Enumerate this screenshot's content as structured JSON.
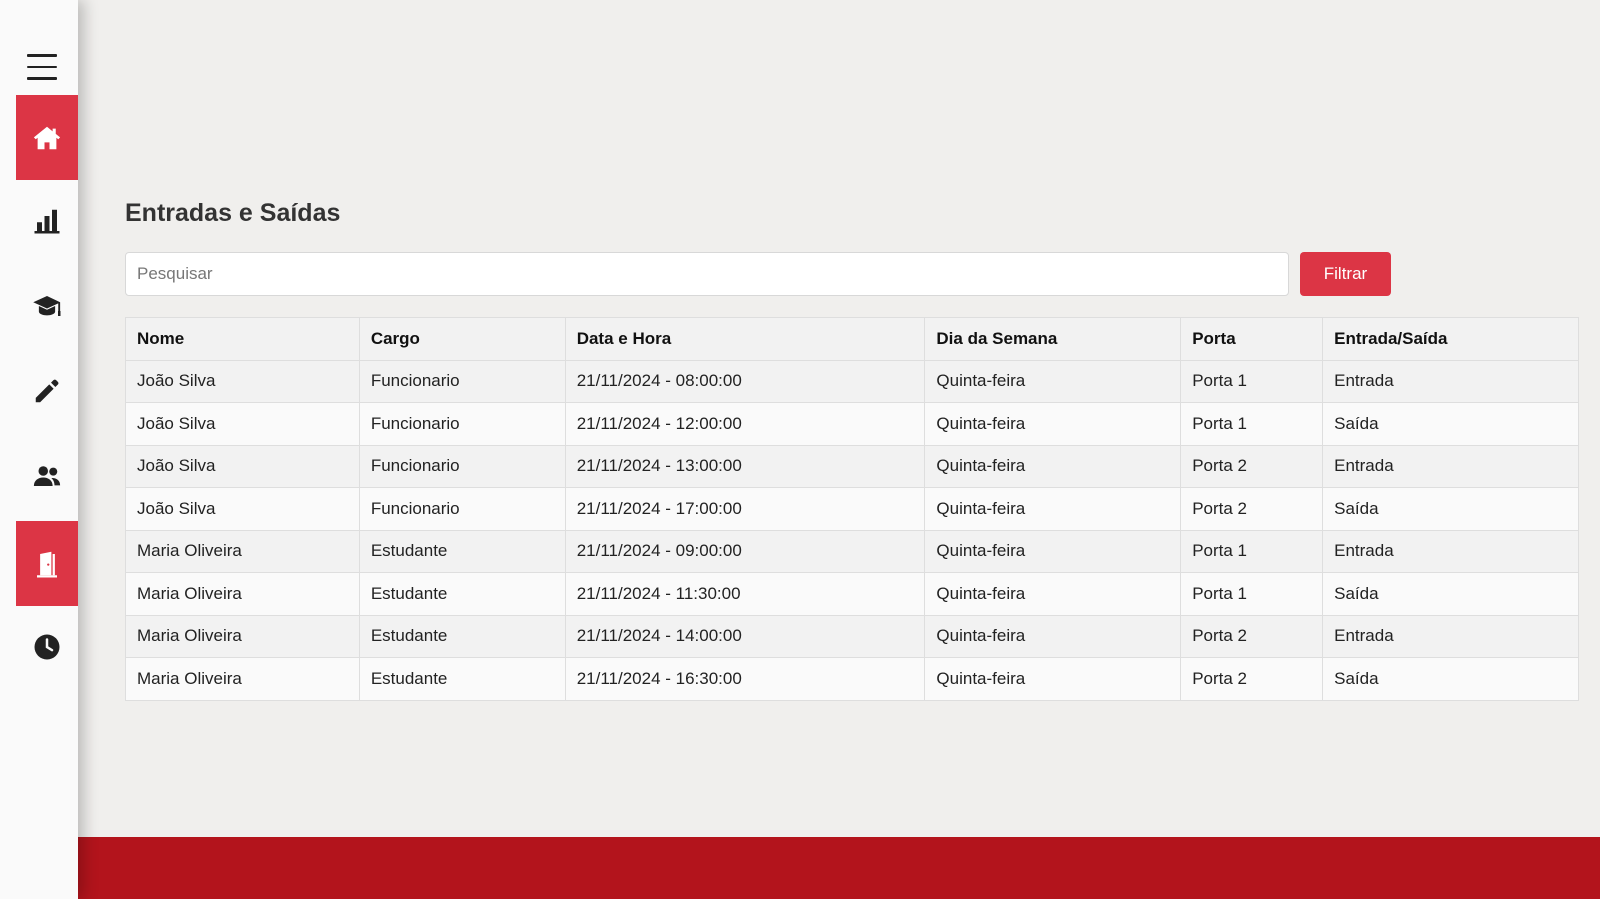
{
  "sidebar": {
    "items": [
      {
        "name": "home",
        "icon": "home-icon",
        "active": true
      },
      {
        "name": "reports",
        "icon": "bar-chart-icon",
        "active": false
      },
      {
        "name": "students",
        "icon": "graduation-cap-icon",
        "active": false
      },
      {
        "name": "edit",
        "icon": "pencil-icon",
        "active": false
      },
      {
        "name": "users",
        "icon": "users-icon",
        "active": false
      },
      {
        "name": "access",
        "icon": "door-icon",
        "active": true
      },
      {
        "name": "history",
        "icon": "clock-icon",
        "active": false
      }
    ]
  },
  "main": {
    "title": "Entradas e Saídas",
    "search": {
      "placeholder": "Pesquisar",
      "value": ""
    },
    "filter_label": "Filtrar",
    "table": {
      "headers": [
        "Nome",
        "Cargo",
        "Data e Hora",
        "Dia da Semana",
        "Porta",
        "Entrada/Saída"
      ],
      "rows": [
        [
          "João Silva",
          "Funcionario",
          "21/11/2024 - 08:00:00",
          "Quinta-feira",
          "Porta 1",
          "Entrada"
        ],
        [
          "João Silva",
          "Funcionario",
          "21/11/2024 - 12:00:00",
          "Quinta-feira",
          "Porta 1",
          "Saída"
        ],
        [
          "João Silva",
          "Funcionario",
          "21/11/2024 - 13:00:00",
          "Quinta-feira",
          "Porta 2",
          "Entrada"
        ],
        [
          "João Silva",
          "Funcionario",
          "21/11/2024 - 17:00:00",
          "Quinta-feira",
          "Porta 2",
          "Saída"
        ],
        [
          "Maria Oliveira",
          "Estudante",
          "21/11/2024 - 09:00:00",
          "Quinta-feira",
          "Porta 1",
          "Entrada"
        ],
        [
          "Maria Oliveira",
          "Estudante",
          "21/11/2024 - 11:30:00",
          "Quinta-feira",
          "Porta 1",
          "Saída"
        ],
        [
          "Maria Oliveira",
          "Estudante",
          "21/11/2024 - 14:00:00",
          "Quinta-feira",
          "Porta 2",
          "Entrada"
        ],
        [
          "Maria Oliveira",
          "Estudante",
          "21/11/2024 - 16:30:00",
          "Quinta-feira",
          "Porta 2",
          "Saída"
        ]
      ]
    }
  },
  "colors": {
    "accent": "#dc3545",
    "footer": "#b3141c",
    "background": "#f0efed",
    "sidebar": "#fafafa"
  }
}
